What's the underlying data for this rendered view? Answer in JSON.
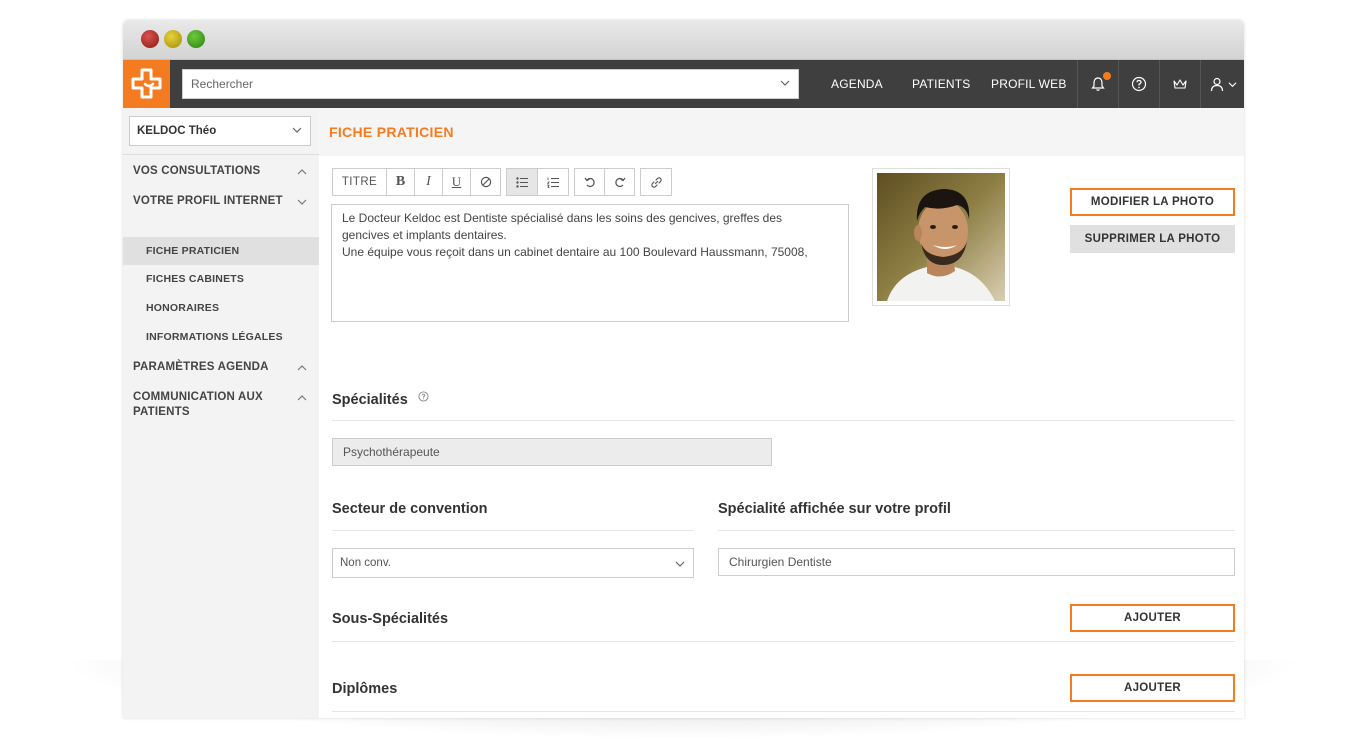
{
  "topbar": {
    "search_placeholder": "Rechercher",
    "nav": [
      "AGENDA",
      "PATIENTS",
      "PROFIL WEB"
    ]
  },
  "sidebar": {
    "practitioner": "KELDOC Théo",
    "sections": [
      {
        "label": "VOS CONSULTATIONS"
      },
      {
        "label": "VOTRE PROFIL INTERNET"
      },
      {
        "label": "PARAMÈTRES AGENDA"
      },
      {
        "label_line1": "COMMUNICATION AUX",
        "label_line2": "PATIENTS"
      }
    ],
    "subitems": [
      "FICHE PRATICIEN",
      "FICHES CABINETS",
      "HONORAIRES",
      "INFORMATIONS LÉGALES"
    ]
  },
  "main": {
    "title": "FICHE PRATICIEN",
    "toolbar": {
      "titre": "TITRE",
      "bold": "B",
      "italic": "I",
      "underline": "U"
    },
    "description": {
      "line1": "Le Docteur Keldoc est Dentiste spécialisé dans les soins des gencives, greffes des",
      "line2": "gencives et implants dentaires.",
      "line3": "Une équipe vous reçoit dans un cabinet dentaire au 100 Boulevard Haussmann, 75008,"
    },
    "photo_buttons": {
      "modify": "MODIFIER LA PHOTO",
      "delete": "SUPPRIMER LA PHOTO"
    },
    "specialites": {
      "title": "Spécialités",
      "value": "Psychothérapeute"
    },
    "secteur": {
      "title": "Secteur de convention",
      "value": "Non conv."
    },
    "specialite_affichee": {
      "title": "Spécialité affichée sur votre profil",
      "value": "Chirurgien Dentiste"
    },
    "sous_specialites": {
      "title": "Sous-Spécialités",
      "button": "AJOUTER"
    },
    "diplomes": {
      "title": "Diplômes",
      "button": "AJOUTER"
    }
  },
  "colors": {
    "accent": "#f47b20",
    "topbar": "#3f3f3f",
    "sidebar": "#f3f3f3"
  }
}
